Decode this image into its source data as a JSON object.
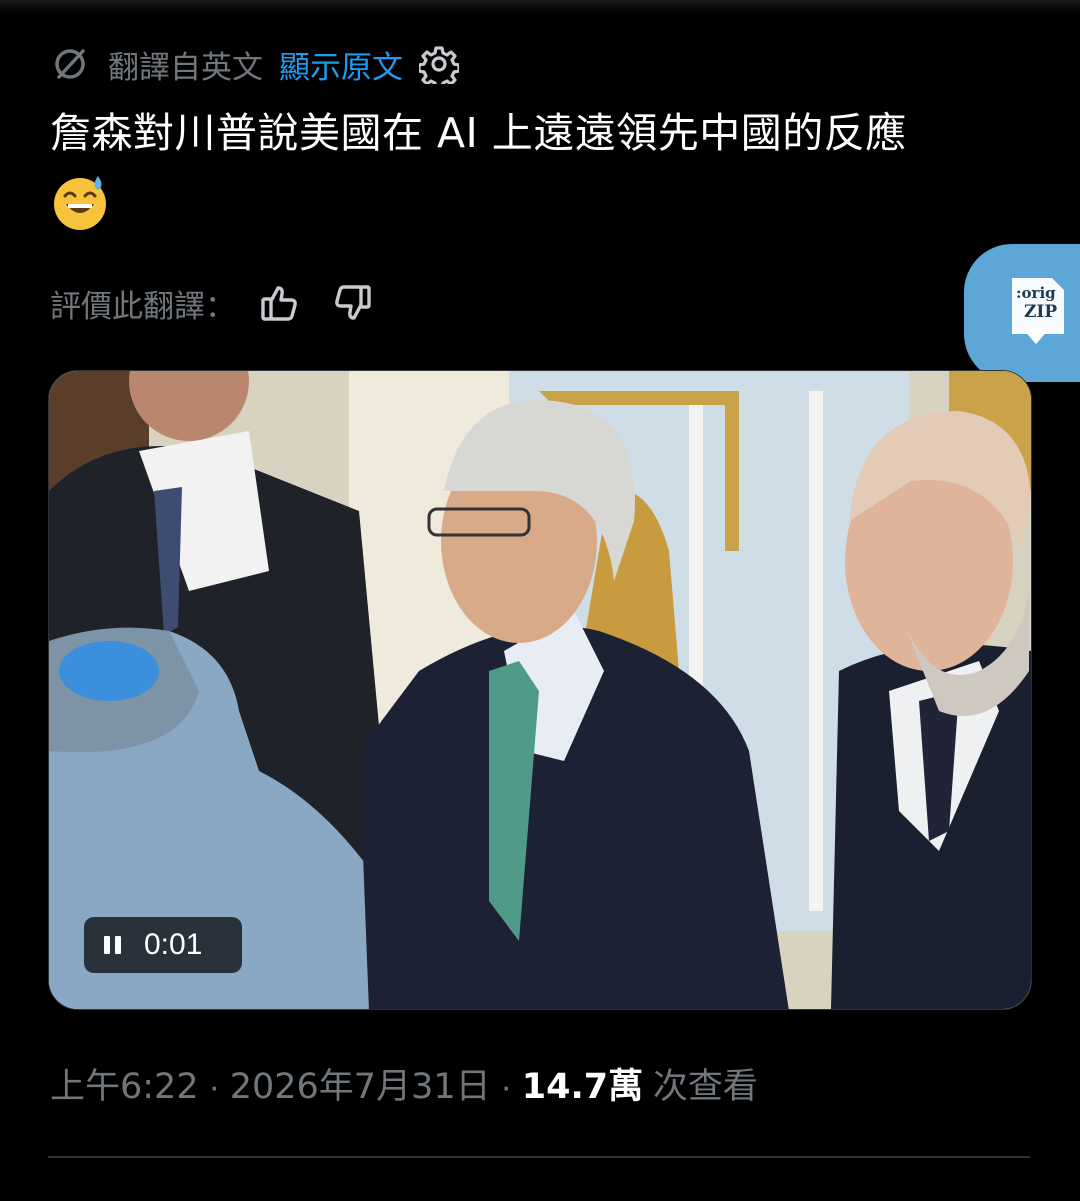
{
  "translation": {
    "label": "翻譯自英文",
    "show_original": "顯示原文"
  },
  "tweet": {
    "text": "詹森對川普說美國在 AI 上遠遠領先中國的反應",
    "emoji": "grinning-face-with-sweat"
  },
  "rating": {
    "label": "評價此翻譯："
  },
  "extension_badge": {
    "line1": ":orig",
    "line2": "ZIP"
  },
  "video": {
    "elapsed": "0:01",
    "state": "playing"
  },
  "meta": {
    "time": "上午6:22",
    "separator": "·",
    "date": "2026年7月31日",
    "views_count": "14.7萬",
    "views_label": "次查看"
  },
  "colors": {
    "background": "#000000",
    "text": "#ffffff",
    "muted": "#71767b",
    "link": "#1d9bf0",
    "badge": "#5da7d8"
  }
}
